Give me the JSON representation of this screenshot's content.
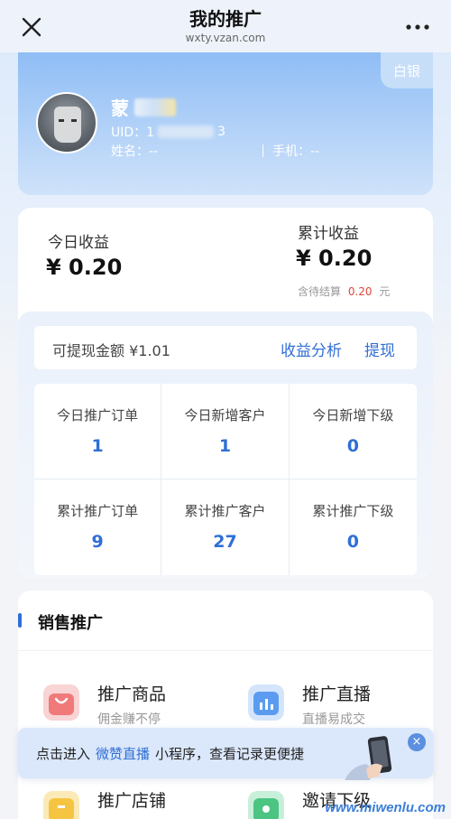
{
  "header": {
    "title": "我的推广",
    "subtitle": "wxty.vzan.com",
    "close_icon": "close-icon",
    "more_icon": "more-icon"
  },
  "profile": {
    "level_badge": "白银",
    "name_prefix": "蒙",
    "uid_label": "UID：1",
    "uid_suffix": "3",
    "name_label": "姓名：--",
    "phone_label": "手机：--"
  },
  "earnings": {
    "today_label": "今日收益",
    "today_value": "¥ 0.20",
    "total_label": "累计收益",
    "total_value": "¥ 0.20",
    "pending_prefix": "含待结算",
    "pending_value": "0.20",
    "pending_unit": "元",
    "withdrawable": "可提现金额 ¥1.01",
    "analysis_link": "收益分析",
    "withdraw_link": "提现"
  },
  "stats": [
    {
      "label": "今日推广订单",
      "value": "1"
    },
    {
      "label": "今日新增客户",
      "value": "1"
    },
    {
      "label": "今日新增下级",
      "value": "0"
    },
    {
      "label": "累计推广订单",
      "value": "9"
    },
    {
      "label": "累计推广客户",
      "value": "27"
    },
    {
      "label": "累计推广下级",
      "value": "0"
    }
  ],
  "sales": {
    "heading": "销售推广",
    "items": [
      {
        "title": "推广商品",
        "sub": "佣金赚不停",
        "icon": "bag-icon",
        "color": "#f07a7a"
      },
      {
        "title": "推广直播",
        "sub": "直播易成交",
        "icon": "chart-icon",
        "color": "#5b9cf0"
      },
      {
        "title": "推广店铺",
        "sub": "",
        "icon": "shop-icon",
        "color": "#f5c542"
      },
      {
        "title": "邀请下级",
        "sub": "",
        "icon": "user-icon",
        "color": "#4cc482"
      }
    ]
  },
  "banner": {
    "before": "点击进入",
    "highlight": "微赞直播",
    "after": "小程序，查看记录更便捷",
    "close": "×"
  },
  "watermark": "www.miwenlu.com",
  "colors": {
    "accent": "#2f6fd6",
    "pending_red": "#e0463a"
  }
}
